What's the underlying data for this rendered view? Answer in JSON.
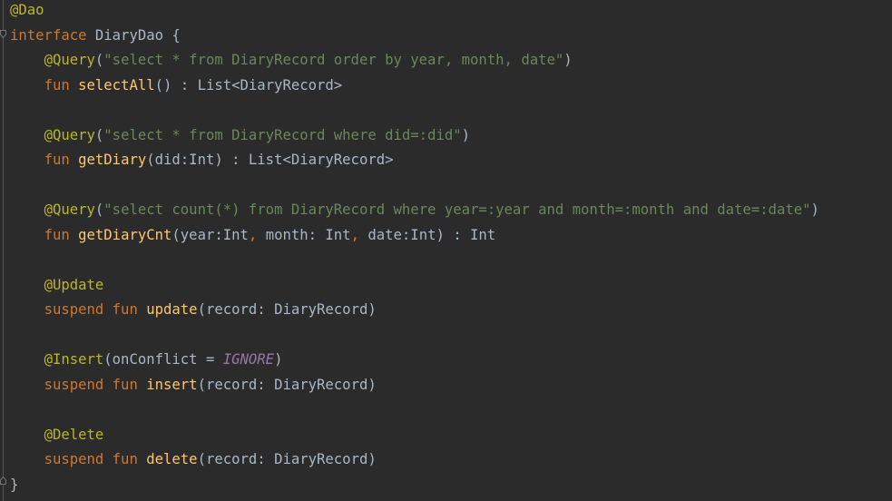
{
  "colors": {
    "background": "#2b2b2b",
    "text": "#a9b7c6",
    "annotation": "#bbb529",
    "keyword": "#cc7832",
    "string": "#6a8759",
    "function": "#ffc66d",
    "constant": "#9876aa"
  },
  "code": [
    {
      "tokens": [
        {
          "type": "annotation",
          "text": "@Dao"
        }
      ]
    },
    {
      "tokens": [
        {
          "type": "keyword",
          "text": "interface "
        },
        {
          "type": "plain",
          "text": "DiaryDao {"
        }
      ]
    },
    {
      "tokens": [
        {
          "type": "plain",
          "text": "    "
        },
        {
          "type": "annotation",
          "text": "@Query"
        },
        {
          "type": "plain",
          "text": "("
        },
        {
          "type": "string",
          "text": "\"select * from DiaryRecord order by year, month, date\""
        },
        {
          "type": "plain",
          "text": ")"
        }
      ]
    },
    {
      "tokens": [
        {
          "type": "plain",
          "text": "    "
        },
        {
          "type": "keyword",
          "text": "fun "
        },
        {
          "type": "function",
          "text": "selectAll"
        },
        {
          "type": "plain",
          "text": "() : List<DiaryRecord>"
        }
      ]
    },
    {
      "tokens": [
        {
          "type": "plain",
          "text": ""
        }
      ]
    },
    {
      "tokens": [
        {
          "type": "plain",
          "text": "    "
        },
        {
          "type": "annotation",
          "text": "@Query"
        },
        {
          "type": "plain",
          "text": "("
        },
        {
          "type": "string",
          "text": "\"select * from DiaryRecord where did=:did\""
        },
        {
          "type": "plain",
          "text": ")"
        }
      ]
    },
    {
      "tokens": [
        {
          "type": "plain",
          "text": "    "
        },
        {
          "type": "keyword",
          "text": "fun "
        },
        {
          "type": "function",
          "text": "getDiary"
        },
        {
          "type": "plain",
          "text": "(did:Int) : List<DiaryRecord>"
        }
      ]
    },
    {
      "tokens": [
        {
          "type": "plain",
          "text": ""
        }
      ]
    },
    {
      "tokens": [
        {
          "type": "plain",
          "text": "    "
        },
        {
          "type": "annotation",
          "text": "@Query"
        },
        {
          "type": "plain",
          "text": "("
        },
        {
          "type": "string",
          "text": "\"select count(*) from DiaryRecord where year=:year and month=:month and date=:date\""
        },
        {
          "type": "plain",
          "text": ")"
        }
      ]
    },
    {
      "tokens": [
        {
          "type": "plain",
          "text": "    "
        },
        {
          "type": "keyword",
          "text": "fun "
        },
        {
          "type": "function",
          "text": "getDiaryCnt"
        },
        {
          "type": "plain",
          "text": "(year:Int"
        },
        {
          "type": "keyword",
          "text": ", "
        },
        {
          "type": "plain",
          "text": "month: Int"
        },
        {
          "type": "keyword",
          "text": ", "
        },
        {
          "type": "plain",
          "text": "date:Int) : Int"
        }
      ]
    },
    {
      "tokens": [
        {
          "type": "plain",
          "text": ""
        }
      ]
    },
    {
      "tokens": [
        {
          "type": "plain",
          "text": "    "
        },
        {
          "type": "annotation",
          "text": "@Update"
        }
      ]
    },
    {
      "tokens": [
        {
          "type": "plain",
          "text": "    "
        },
        {
          "type": "keyword",
          "text": "suspend fun "
        },
        {
          "type": "function",
          "text": "update"
        },
        {
          "type": "plain",
          "text": "(record: DiaryRecord)"
        }
      ]
    },
    {
      "tokens": [
        {
          "type": "plain",
          "text": ""
        }
      ]
    },
    {
      "tokens": [
        {
          "type": "plain",
          "text": "    "
        },
        {
          "type": "annotation",
          "text": "@Insert"
        },
        {
          "type": "plain",
          "text": "(onConflict = "
        },
        {
          "type": "const",
          "text": "IGNORE"
        },
        {
          "type": "plain",
          "text": ")"
        }
      ]
    },
    {
      "tokens": [
        {
          "type": "plain",
          "text": "    "
        },
        {
          "type": "keyword",
          "text": "suspend fun "
        },
        {
          "type": "function",
          "text": "insert"
        },
        {
          "type": "plain",
          "text": "(record: DiaryRecord)"
        }
      ]
    },
    {
      "tokens": [
        {
          "type": "plain",
          "text": ""
        }
      ]
    },
    {
      "tokens": [
        {
          "type": "plain",
          "text": "    "
        },
        {
          "type": "annotation",
          "text": "@Delete"
        }
      ]
    },
    {
      "tokens": [
        {
          "type": "plain",
          "text": "    "
        },
        {
          "type": "keyword",
          "text": "suspend fun "
        },
        {
          "type": "function",
          "text": "delete"
        },
        {
          "type": "plain",
          "text": "(record: DiaryRecord)"
        }
      ]
    },
    {
      "tokens": [
        {
          "type": "plain",
          "text": "}"
        }
      ]
    }
  ]
}
